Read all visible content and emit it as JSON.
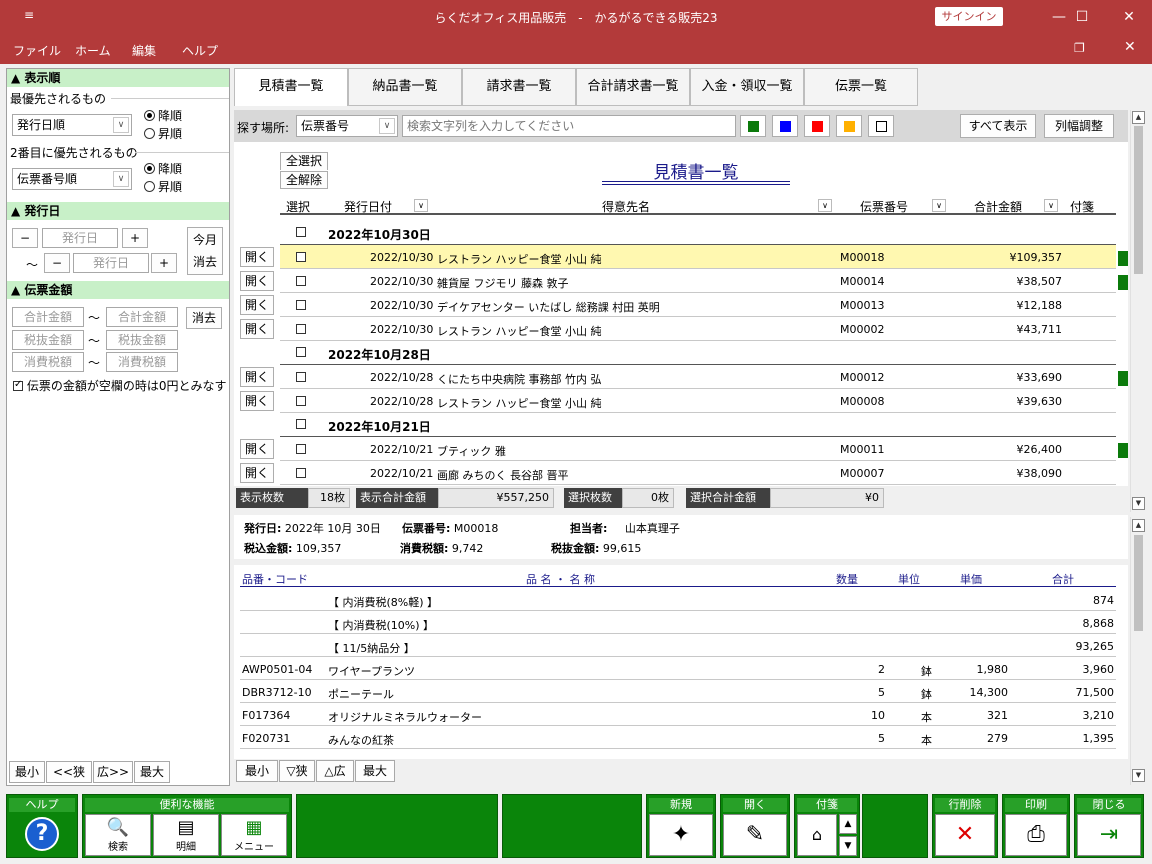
{
  "window": {
    "title": "らくだオフィス用品販売　-　かるがるできる販売23",
    "signin": "サインイン",
    "sys_icon": "≡"
  },
  "menu": [
    "ファイル",
    "ホーム",
    "編集",
    "ヘルプ"
  ],
  "left": {
    "sort_head": "▲ 表示順",
    "first_label": "最優先されるもの",
    "first_value": "発行日順",
    "second_label": "2番目に優先されるもの",
    "second_value": "伝票番号順",
    "desc": "降順",
    "asc": "昇順",
    "date_head": "▲ 発行日",
    "minus": "−",
    "plus": "+",
    "date_placeholder": "発行日",
    "tilde": "〜",
    "this_month": "今月",
    "clear": "消去",
    "amount_head": "▲ 伝票金額",
    "total_amount": "合計金額",
    "pre_tax": "税抜金額",
    "tax": "消費税額",
    "zero_check": "伝票の金額が空欄の時は0円とみなす",
    "zoom": [
      "最小",
      "<<狭",
      "広>>",
      "最大"
    ]
  },
  "tabs": [
    "見積書一覧",
    "納品書一覧",
    "請求書一覧",
    "合計請求書一覧",
    "入金・領収一覧",
    "伝票一覧"
  ],
  "toolbar": {
    "search_label": "探す場所:",
    "search_field": "伝票番号",
    "search_placeholder": "検索文字列を入力してください",
    "show_all": "すべて表示",
    "col_adjust": "列幅調整",
    "colors": [
      "#0b7a0b",
      "#0000ff",
      "#ff0000",
      "#ffb000",
      "#ffffff"
    ]
  },
  "list": {
    "select_all": "全選択",
    "deselect_all": "全解除",
    "title": "見積書一覧",
    "headers": {
      "sel": "選択",
      "date": "発行日付",
      "customer": "得意先名",
      "number": "伝票番号",
      "total": "合計金額",
      "tag": "付箋"
    },
    "open": "開く",
    "groups": [
      {
        "label": "2022年10月30日",
        "rows": [
          {
            "date": "2022/10/30",
            "customer": "レストラン ハッピー食堂 小山 純",
            "number": "M00018",
            "total": "¥109,357",
            "tag": true,
            "selected": true
          },
          {
            "date": "2022/10/30",
            "customer": "雑貨屋 フジモリ 藤森 敦子",
            "number": "M00014",
            "total": "¥38,507",
            "tag": true
          },
          {
            "date": "2022/10/30",
            "customer": "デイケアセンター いたばし 総務課 村田 英明",
            "number": "M00013",
            "total": "¥12,188",
            "tag": false
          },
          {
            "date": "2022/10/30",
            "customer": "レストラン ハッピー食堂 小山 純",
            "number": "M00002",
            "total": "¥43,711",
            "tag": false
          }
        ]
      },
      {
        "label": "2022年10月28日",
        "rows": [
          {
            "date": "2022/10/28",
            "customer": "くにたち中央病院 事務部 竹内 弘",
            "number": "M00012",
            "total": "¥33,690",
            "tag": true
          },
          {
            "date": "2022/10/28",
            "customer": "レストラン ハッピー食堂 小山 純",
            "number": "M00008",
            "total": "¥39,630",
            "tag": false
          }
        ]
      },
      {
        "label": "2022年10月21日",
        "rows": [
          {
            "date": "2022/10/21",
            "customer": "ブティック 雅",
            "number": "M00011",
            "total": "¥26,400",
            "tag": true
          },
          {
            "date": "2022/10/21",
            "customer": "画廊 みちのく 長谷部 晋平",
            "number": "M00007",
            "total": "¥38,090",
            "tag": false
          }
        ]
      }
    ]
  },
  "status": {
    "count_label": "表示枚数",
    "count": "18枚",
    "sum_label": "表示合計金額",
    "sum": "¥557,250",
    "sel_label": "選択枚数",
    "sel": "0枚",
    "sel_sum_label": "選択合計金額",
    "sel_sum": "¥0"
  },
  "detail": {
    "date_label": "発行日:",
    "date": "2022年 10月 30日",
    "num_label": "伝票番号:",
    "num": "M00018",
    "staff_label": "担当者:",
    "staff": "山本真理子",
    "incl_label": "税込金額:",
    "incl": "109,357",
    "tax_label": "消費税額:",
    "tax": "9,742",
    "excl_label": "税抜金額:",
    "excl": "99,615",
    "headers": {
      "code": "品番・コード",
      "name": "品 名 ・ 名 称",
      "qty": "数量",
      "unit": "単位",
      "price": "単価",
      "total": "合計"
    },
    "rows": [
      {
        "code": "",
        "name": "【 内消費税(8%軽) 】",
        "qty": "",
        "unit": "",
        "price": "",
        "total": "874"
      },
      {
        "code": "",
        "name": "【 内消費税(10%) 】",
        "qty": "",
        "unit": "",
        "price": "",
        "total": "8,868"
      },
      {
        "code": "",
        "name": "【 11/5納品分 】",
        "qty": "",
        "unit": "",
        "price": "",
        "total": "93,265"
      },
      {
        "code": "AWP0501-04",
        "name": "ワイヤープランツ",
        "qty": "2",
        "unit": "鉢",
        "price": "1,980",
        "total": "3,960"
      },
      {
        "code": "DBR3712-10",
        "name": "ポニーテール",
        "qty": "5",
        "unit": "鉢",
        "price": "14,300",
        "total": "71,500"
      },
      {
        "code": "F017364",
        "name": "オリジナルミネラルウォーター",
        "qty": "10",
        "unit": "本",
        "price": "321",
        "total": "3,210"
      },
      {
        "code": "F020731",
        "name": "みんなの紅茶",
        "qty": "5",
        "unit": "本",
        "price": "279",
        "total": "1,395"
      }
    ],
    "zoom": [
      "最小",
      "▽狭",
      "△広",
      "最大"
    ]
  },
  "bottom": {
    "help": "ヘルプ",
    "tools": "便利な機能",
    "search": "検索",
    "detail": "明細",
    "menu": "メニュー",
    "new": "新規",
    "open": "開く",
    "tag": "付箋",
    "delete": "行削除",
    "print": "印刷",
    "close": "閉じる"
  }
}
